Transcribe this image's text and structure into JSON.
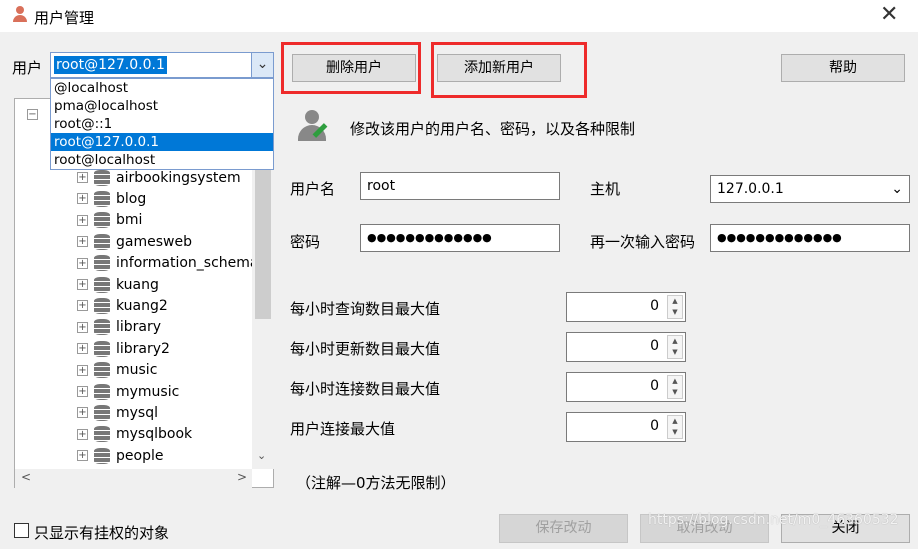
{
  "window": {
    "title": "用户管理",
    "close": "✕"
  },
  "user": {
    "label": "用户",
    "selected": "root@127.0.0.1",
    "options": [
      "@localhost",
      "pma@localhost",
      "root@::1",
      "root@127.0.0.1",
      "root@localhost"
    ]
  },
  "buttons": {
    "delete": "删除用户",
    "add": "添加新用户",
    "help": "帮助",
    "save": "保存改动",
    "cancel": "取消改动",
    "close": "关闭"
  },
  "tree": {
    "items": [
      "airbookingsystem",
      "blog",
      "bmi",
      "gamesweb",
      "information_schema",
      "kuang",
      "kuang2",
      "library",
      "library2",
      "music",
      "mymusic",
      "mysql",
      "mysqlbook",
      "people"
    ]
  },
  "form": {
    "heading": "修改该用户的用户名、密码，以及各种限制",
    "username_label": "用户名",
    "username": "root",
    "host_label": "主机",
    "host": "127.0.0.1",
    "password_label": "密码",
    "password": "●●●●●●●●●●●●●",
    "password2_label": "再一次输入密码",
    "password2": "●●●●●●●●●●●●●",
    "limits": [
      {
        "label": "每小时查询数目最大值",
        "value": "0"
      },
      {
        "label": "每小时更新数目最大值",
        "value": "0"
      },
      {
        "label": "每小时连接数目最大值",
        "value": "0"
      },
      {
        "label": "用户连接最大值",
        "value": "0"
      }
    ],
    "note": "（注解—0方法无限制）"
  },
  "show_privileged": "只显示有挂权的对象",
  "watermark": "https://blog.csdn.net/m0_46360532",
  "colors": {
    "highlight": "#0078d7",
    "annotation": "#ee2b2b"
  }
}
